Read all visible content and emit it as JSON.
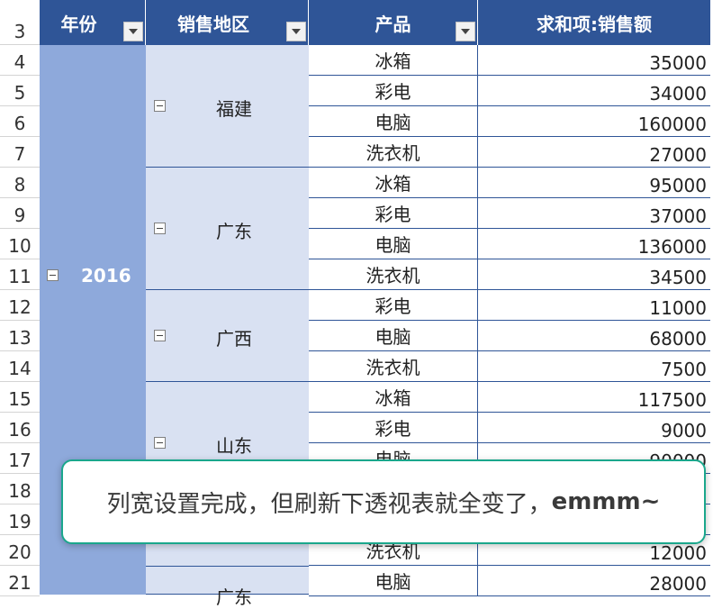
{
  "headers": {
    "year": "年份",
    "region": "销售地区",
    "product": "产品",
    "sum": "求和项:销售额"
  },
  "header_row_number": "3",
  "year_value": "2016",
  "regions": [
    {
      "name": "福建"
    },
    {
      "name": "广东"
    },
    {
      "name": "广西"
    },
    {
      "name": "山东"
    },
    {
      "name": "广东"
    }
  ],
  "rows": [
    {
      "n": "4",
      "product": "冰箱",
      "value": "35000"
    },
    {
      "n": "5",
      "product": "彩电",
      "value": "34000"
    },
    {
      "n": "6",
      "product": "电脑",
      "value": "160000"
    },
    {
      "n": "7",
      "product": "洗衣机",
      "value": "27000"
    },
    {
      "n": "8",
      "product": "冰箱",
      "value": "95000"
    },
    {
      "n": "9",
      "product": "彩电",
      "value": "37000"
    },
    {
      "n": "10",
      "product": "电脑",
      "value": "136000"
    },
    {
      "n": "11",
      "product": "洗衣机",
      "value": "34500"
    },
    {
      "n": "12",
      "product": "彩电",
      "value": "11000"
    },
    {
      "n": "13",
      "product": "电脑",
      "value": "68000"
    },
    {
      "n": "14",
      "product": "洗衣机",
      "value": "7500"
    },
    {
      "n": "15",
      "product": "冰箱",
      "value": "117500"
    },
    {
      "n": "16",
      "product": "彩电",
      "value": "9000"
    },
    {
      "n": "17",
      "product": "电脑",
      "value": "90000"
    },
    {
      "n": "18",
      "product": "",
      "value": ""
    },
    {
      "n": "19",
      "product": "",
      "value": ""
    },
    {
      "n": "20",
      "product": "洗衣机",
      "value": "12000"
    },
    {
      "n": "21",
      "product": "电脑",
      "value": "28000"
    }
  ],
  "toast": {
    "text": "列宽设置完成，但刷新下透视表就全变了，",
    "emphasis": "emmm~"
  }
}
